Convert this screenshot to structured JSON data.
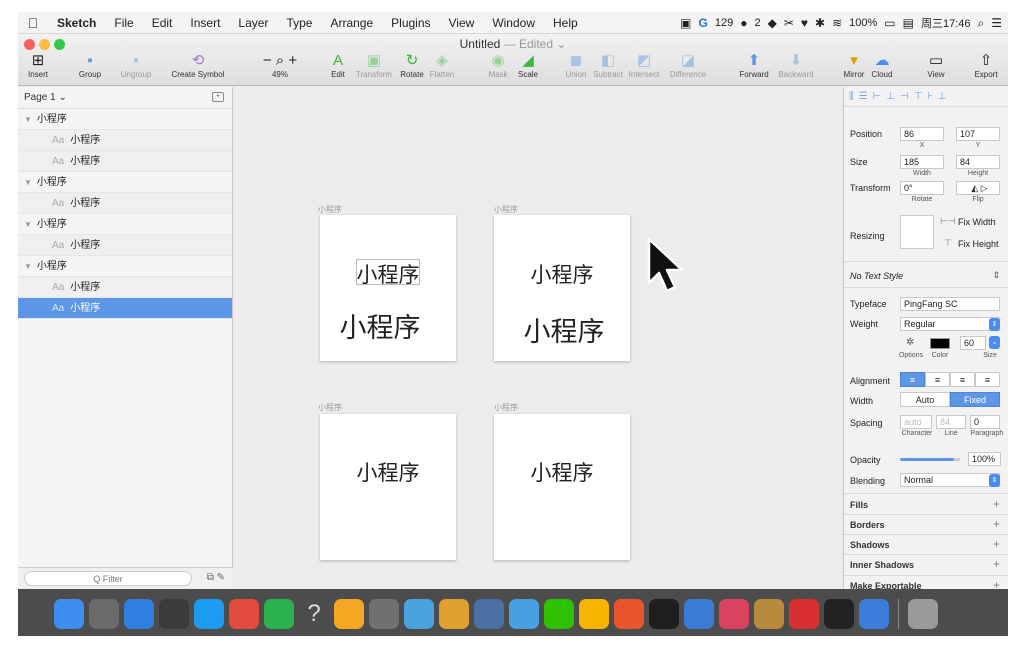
{
  "menubar": {
    "apple": "",
    "app_name": "Sketch",
    "menus": [
      "File",
      "Edit",
      "Insert",
      "Layer",
      "Type",
      "Arrange",
      "Plugins",
      "View",
      "Window",
      "Help"
    ],
    "status": {
      "count_a": "129",
      "count_b": "2",
      "battery": "100%",
      "clock": "周三17:46"
    }
  },
  "toolbar": {
    "title": "Untitled",
    "edited": "— Edited ⌄",
    "insert": "Insert",
    "group": "Group",
    "ungroup": "Ungroup",
    "create_symbol": "Create Symbol",
    "zoom": "49%",
    "edit": "Edit",
    "transform": "Transform",
    "rotate": "Rotate",
    "flatten": "Flatten",
    "mask": "Mask",
    "scale": "Scale",
    "union": "Union",
    "subtract": "Subtract",
    "intersect": "Intersect",
    "difference": "Difference",
    "forward": "Forward",
    "backward": "Backward",
    "mirror": "Mirror",
    "cloud": "Cloud",
    "view": "View",
    "export": "Export"
  },
  "layers": {
    "page": "Page 1 ⌄",
    "rows": [
      {
        "kind": "group",
        "label": "小程序"
      },
      {
        "kind": "child",
        "label": "小程序"
      },
      {
        "kind": "child",
        "label": "小程序"
      },
      {
        "kind": "group",
        "label": "小程序"
      },
      {
        "kind": "child",
        "label": "小程序"
      },
      {
        "kind": "group",
        "label": "小程序"
      },
      {
        "kind": "child",
        "label": "小程序"
      },
      {
        "kind": "group",
        "label": "小程序"
      },
      {
        "kind": "child",
        "label": "小程序"
      },
      {
        "kind": "child",
        "label": "小程序",
        "selected": true
      }
    ],
    "aa": "Aa",
    "filter_placeholder": "Q Filter"
  },
  "canvas": {
    "artboards": [
      {
        "label": "小程序",
        "texts": [
          "小程序",
          "小程序"
        ]
      },
      {
        "label": "小程序",
        "texts": [
          "小程序",
          "小程序"
        ]
      },
      {
        "label": "小程序",
        "texts": [
          "小程序"
        ]
      },
      {
        "label": "小程序",
        "texts": [
          "小程序"
        ]
      }
    ]
  },
  "inspector": {
    "position_label": "Position",
    "pos_x": "86",
    "pos_y": "107",
    "x_label": "X",
    "y_label": "Y",
    "size_label": "Size",
    "width": "185",
    "height": "84",
    "width_label": "Width",
    "height_label": "Height",
    "transform_label": "Transform",
    "rotate_value": "0°",
    "rotate_label": "Rotate",
    "flip_label": "Flip",
    "resizing_label": "Resizing",
    "fix_width": "Fix Width",
    "fix_height": "Fix Height",
    "text_style": "No Text Style",
    "typeface_label": "Typeface",
    "typeface": "PingFang SC",
    "weight_label": "Weight",
    "weight": "Regular",
    "options_label": "Options",
    "color_label": "Color",
    "font_size": "60",
    "size_small_label": "Size",
    "alignment_label": "Alignment",
    "width_mode_label": "Width",
    "auto": "Auto",
    "fixed": "Fixed",
    "spacing_label": "Spacing",
    "char_spacing": "auto",
    "line_spacing": "84",
    "para_spacing": "0",
    "character_label": "Character",
    "line_label": "Line",
    "paragraph_label": "Paragraph",
    "opacity_label": "Opacity",
    "opacity": "100%",
    "opacity_fraction": 0.9,
    "blending_label": "Blending",
    "blending": "Normal",
    "fills": "Fills",
    "borders": "Borders",
    "shadows": "Shadows",
    "inner_shadows": "Inner Shadows",
    "make_exportable": "Make Exportable"
  },
  "colors": {
    "accent": "#5d96e6",
    "selected_row": "#5d96e6",
    "canvas": "#ececec"
  },
  "dock": {
    "icons": [
      "finder-icon",
      "launchpad-icon",
      "safari-icon",
      "calculator-icon",
      "qq-icon",
      "chrome-icon",
      "wechat-work-icon",
      "help-icon",
      "photos-icon",
      "system-preferences-icon",
      "tweetbot-icon",
      "sequel-icon",
      "wireless-icon",
      "maps-icon",
      "wechat-icon",
      "sketch-icon",
      "hammer-icon",
      "terminal-icon",
      "preview-icon",
      "itunes-icon",
      "transmit-icon",
      "netease-icon",
      "github-icon",
      "finder-alt-icon",
      "trash-icon"
    ],
    "help_glyph": "?"
  }
}
